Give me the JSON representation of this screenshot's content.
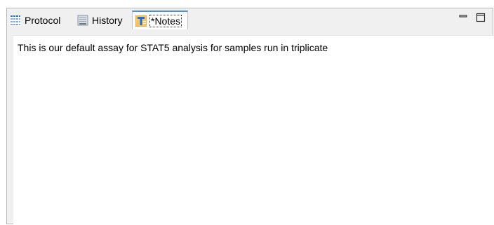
{
  "tabs": [
    {
      "label": "Protocol",
      "icon": "grid-icon",
      "active": false
    },
    {
      "label": "History",
      "icon": "log-icon",
      "active": false
    },
    {
      "label": "*Notes",
      "icon": "text-notes-icon",
      "active": true
    }
  ],
  "window_controls": {
    "minimize_icon": "minimize-icon",
    "maximize_icon": "maximize-icon"
  },
  "notes": {
    "text": "This is our default assay for STAT5 analysis for samples run in triplicate"
  },
  "colors": {
    "active_tab_accent": "#4f8fd6",
    "grid_icon": "#2f6fd0",
    "notes_icon": "#f0a020"
  }
}
